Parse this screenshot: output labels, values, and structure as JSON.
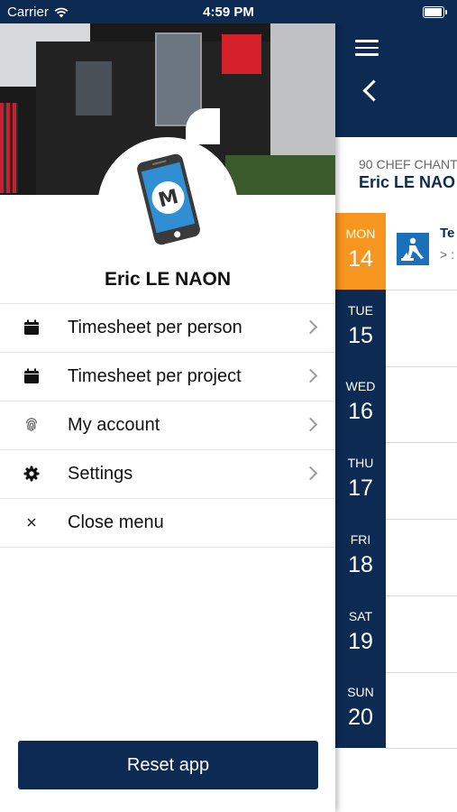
{
  "status_bar": {
    "carrier": "Carrier",
    "time": "4:59 PM"
  },
  "profile": {
    "name": "Eric LE NAON",
    "avatar_letter": "M"
  },
  "menu": [
    {
      "label": "Timesheet per person",
      "icon": "calendar-icon",
      "has_chevron": true
    },
    {
      "label": "Timesheet per project",
      "icon": "calendar-icon",
      "has_chevron": true
    },
    {
      "label": "My account",
      "icon": "fingerprint-icon",
      "has_chevron": true
    },
    {
      "label": "Settings",
      "icon": "gear-icon",
      "has_chevron": true
    },
    {
      "label": "Close menu",
      "icon": "close-icon",
      "has_chevron": false
    }
  ],
  "reset_button": {
    "label": "Reset app"
  },
  "background_view": {
    "project_code": "90 CHEF CHANT",
    "project_person": "Eric LE NAO",
    "task_title": "Te",
    "task_sub": "> :",
    "days": [
      {
        "name": "MON",
        "num": "14",
        "active": true
      },
      {
        "name": "TUE",
        "num": "15",
        "active": false
      },
      {
        "name": "WED",
        "num": "16",
        "active": false
      },
      {
        "name": "THU",
        "num": "17",
        "active": false
      },
      {
        "name": "FRI",
        "num": "18",
        "active": false
      },
      {
        "name": "SAT",
        "num": "19",
        "active": false
      },
      {
        "name": "SUN",
        "num": "20",
        "active": false
      }
    ]
  },
  "colors": {
    "navy": "#0c2a52",
    "active_day": "#f7961e",
    "task_icon": "#1b71b9"
  }
}
